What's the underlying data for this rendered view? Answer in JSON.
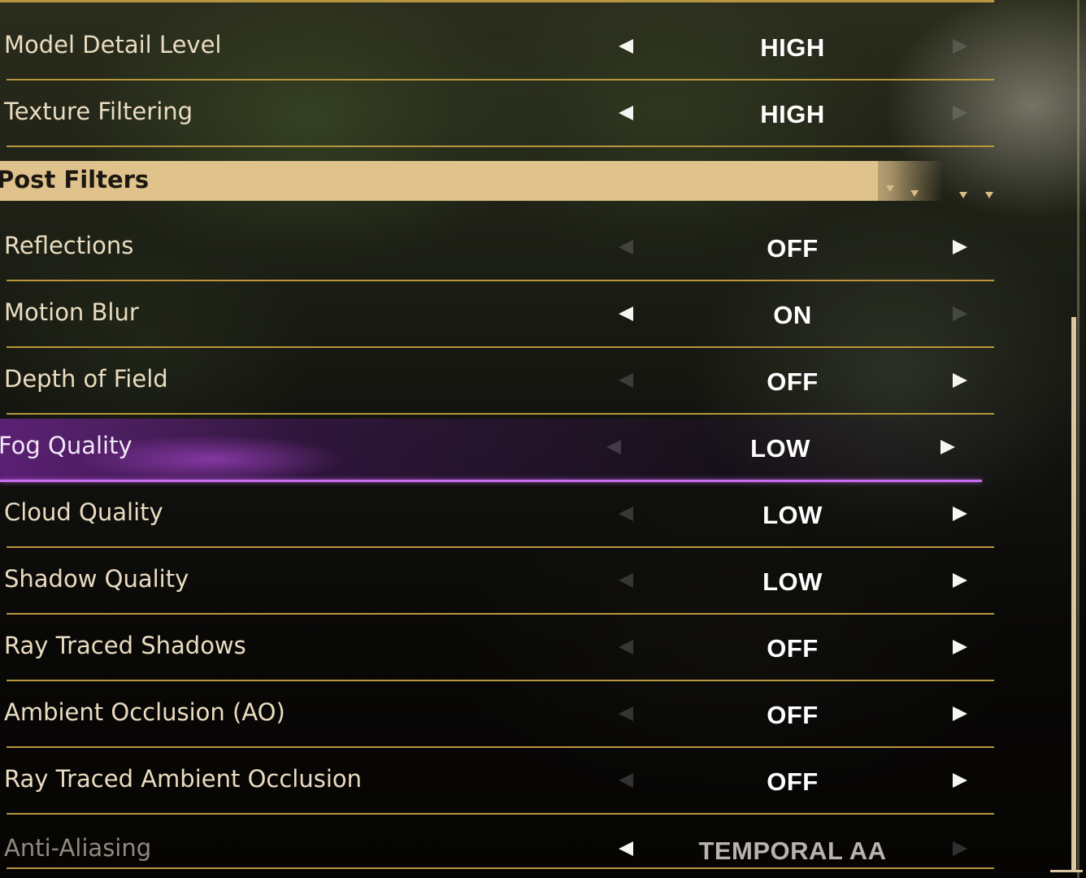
{
  "section": {
    "title": "Post Filters"
  },
  "settings": [
    {
      "label": "Model Detail Level",
      "value": "HIGH",
      "left_enabled": true,
      "right_enabled": false
    },
    {
      "label": "Texture Filtering",
      "value": "HIGH",
      "left_enabled": true,
      "right_enabled": false
    },
    {
      "label": "Reflections",
      "value": "OFF",
      "left_enabled": false,
      "right_enabled": true
    },
    {
      "label": "Motion Blur",
      "value": "ON",
      "left_enabled": true,
      "right_enabled": false
    },
    {
      "label": "Depth of Field",
      "value": "OFF",
      "left_enabled": false,
      "right_enabled": true
    },
    {
      "label": "Fog Quality",
      "value": "LOW",
      "left_enabled": false,
      "right_enabled": true,
      "selected": true
    },
    {
      "label": "Cloud Quality",
      "value": "LOW",
      "left_enabled": false,
      "right_enabled": true
    },
    {
      "label": "Shadow Quality",
      "value": "LOW",
      "left_enabled": false,
      "right_enabled": true
    },
    {
      "label": "Ray Traced Shadows",
      "value": "OFF",
      "left_enabled": false,
      "right_enabled": true
    },
    {
      "label": "Ambient Occlusion (AO)",
      "value": "OFF",
      "left_enabled": false,
      "right_enabled": true
    },
    {
      "label": "Ray Traced Ambient Occlusion",
      "value": "OFF",
      "left_enabled": false,
      "right_enabled": true
    },
    {
      "label": "Anti-Aliasing",
      "value": "TEMPORAL AA",
      "left_enabled": true,
      "right_enabled": false,
      "disabled": true
    }
  ],
  "colors": {
    "accent_gold": "#b8963f",
    "header_band": "#e0c38c",
    "selection_purple": "#c86df0",
    "label_text": "#e9dcc0",
    "value_text": "#ffffff"
  },
  "icons": {
    "left_arrow": "triangle-left-icon",
    "right_arrow": "triangle-right-icon"
  }
}
